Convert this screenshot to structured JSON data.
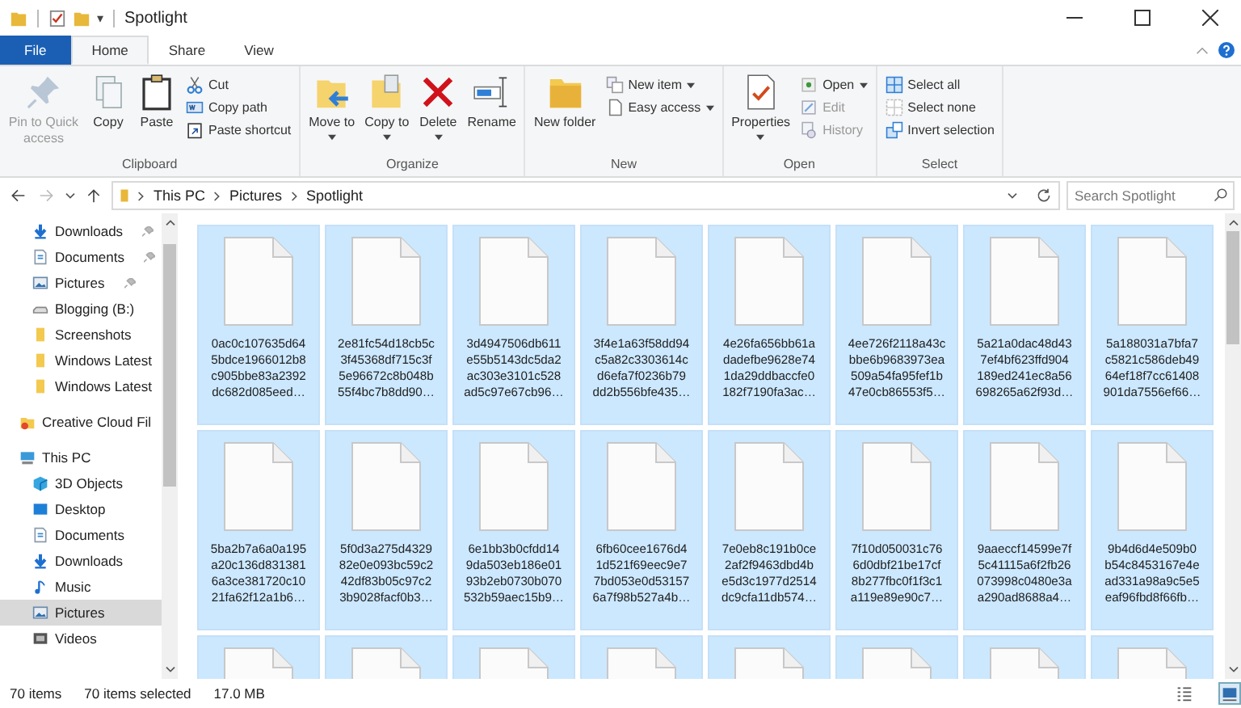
{
  "title_bar": {
    "title": "Spotlight",
    "customize_caret": "▾"
  },
  "tabs": [
    {
      "label": "File",
      "kind": "file",
      "selected": false
    },
    {
      "label": "Home",
      "kind": "tab",
      "selected": true
    },
    {
      "label": "Share",
      "kind": "tab",
      "selected": false
    },
    {
      "label": "View",
      "kind": "tab",
      "selected": false
    }
  ],
  "ribbon": {
    "groups": [
      {
        "label": "Clipboard",
        "large": [
          {
            "label": "Pin to Quick access",
            "kind": "pin",
            "disabled": true,
            "dropdown": false
          },
          {
            "label": "Copy",
            "kind": "copy",
            "disabled": false,
            "dropdown": false
          },
          {
            "label": "Paste",
            "kind": "paste",
            "disabled": false,
            "dropdown": false
          }
        ],
        "small": [
          {
            "label": "Cut",
            "kind": "cut",
            "disabled": false,
            "dropdown": false
          },
          {
            "label": "Copy path",
            "kind": "copy-path",
            "disabled": false,
            "dropdown": false
          },
          {
            "label": "Paste shortcut",
            "kind": "paste-shortcut",
            "disabled": false,
            "dropdown": false
          }
        ]
      },
      {
        "label": "Organize",
        "large": [
          {
            "label": "Move to",
            "kind": "move",
            "disabled": false,
            "dropdown": true
          },
          {
            "label": "Copy to",
            "kind": "copy-to",
            "disabled": false,
            "dropdown": true
          },
          {
            "label": "Delete",
            "kind": "delete",
            "disabled": false,
            "dropdown": true
          },
          {
            "label": "Rename",
            "kind": "rename",
            "disabled": false,
            "dropdown": false
          }
        ]
      },
      {
        "label": "New",
        "large": [
          {
            "label": "New folder",
            "kind": "folder",
            "disabled": false,
            "dropdown": false
          }
        ],
        "small": [
          {
            "label": "New item",
            "kind": "new-item",
            "disabled": false,
            "dropdown": true
          },
          {
            "label": "Easy access",
            "kind": "easy-access",
            "disabled": false,
            "dropdown": true
          }
        ]
      },
      {
        "label": "Open",
        "large": [
          {
            "label": "Properties",
            "kind": "properties",
            "disabled": false,
            "dropdown": true
          }
        ],
        "small": [
          {
            "label": "Open",
            "kind": "open",
            "disabled": false,
            "dropdown": true
          },
          {
            "label": "Edit",
            "kind": "edit",
            "disabled": true,
            "dropdown": false
          },
          {
            "label": "History",
            "kind": "history",
            "disabled": true,
            "dropdown": false
          }
        ]
      },
      {
        "label": "Select",
        "small": [
          {
            "label": "Select all",
            "kind": "select-all",
            "disabled": false,
            "dropdown": false
          },
          {
            "label": "Select none",
            "kind": "select-none",
            "disabled": false,
            "dropdown": false
          },
          {
            "label": "Invert selection",
            "kind": "invert",
            "disabled": false,
            "dropdown": false
          }
        ]
      }
    ]
  },
  "address_bar": {
    "path": [
      "This PC",
      "Pictures",
      "Spotlight"
    ]
  },
  "search": {
    "placeholder": "Search Spotlight"
  },
  "navigation": [
    {
      "items": [
        {
          "label": "Downloads",
          "kind": "download",
          "pinned": true,
          "selected": false
        },
        {
          "label": "Documents",
          "kind": "document",
          "pinned": true,
          "selected": false
        },
        {
          "label": "Pictures",
          "kind": "picture",
          "pinned": true,
          "selected": false
        },
        {
          "label": "Blogging (B:)",
          "kind": "drive",
          "selected": false
        },
        {
          "label": "Screenshots",
          "kind": "folder",
          "selected": false
        },
        {
          "label": "Windows Latest",
          "kind": "folder",
          "selected": false
        },
        {
          "label": "Windows Latest",
          "kind": "folder",
          "selected": false
        }
      ]
    },
    {
      "items": [
        {
          "label": "Creative Cloud Fil",
          "kind": "cloud",
          "selected": false
        }
      ]
    },
    {
      "items": [
        {
          "label": "This PC",
          "kind": "pc",
          "selected": false,
          "children": [
            {
              "label": "3D Objects",
              "kind": "cube",
              "selected": false
            },
            {
              "label": "Desktop",
              "kind": "desktop",
              "selected": false
            },
            {
              "label": "Documents",
              "kind": "document",
              "selected": false
            },
            {
              "label": "Downloads",
              "kind": "download",
              "selected": false
            },
            {
              "label": "Music",
              "kind": "music",
              "selected": false
            },
            {
              "label": "Pictures",
              "kind": "picture",
              "selected": true
            },
            {
              "label": "Videos",
              "kind": "video",
              "selected": false
            }
          ]
        }
      ]
    }
  ],
  "files": [
    {
      "name_lines": [
        "0ac0c107635d64",
        "5bdce1966012b8",
        "c905bbe83a2392",
        "dc682d085eed…"
      ],
      "selected": true
    },
    {
      "name_lines": [
        "2e81fc54d18cb5c",
        "3f45368df715c3f",
        "5e96672c8b048b",
        "55f4bc7b8dd90…"
      ],
      "selected": true
    },
    {
      "name_lines": [
        "3d4947506db611",
        "e55b5143dc5da2",
        "ac303e3101c528",
        "ad5c97e67cb96…"
      ],
      "selected": true
    },
    {
      "name_lines": [
        "3f4e1a63f58dd94",
        "c5a82c3303614c",
        "d6efa7f0236b79",
        "dd2b556bfe435…"
      ],
      "selected": true
    },
    {
      "name_lines": [
        "4e26fa656bb61a",
        "dadefbe9628e74",
        "1da29ddbaccfe0",
        "182f7190fa3ac…"
      ],
      "selected": true
    },
    {
      "name_lines": [
        "4ee726f2118a43c",
        "bbe6b9683973ea",
        "509a54fa95fef1b",
        "47e0cb86553f5…"
      ],
      "selected": true
    },
    {
      "name_lines": [
        "5a21a0dac48d43",
        "7ef4bf623ffd904",
        "189ed241ec8a56",
        "698265a62f93d…"
      ],
      "selected": true
    },
    {
      "name_lines": [
        "5a188031a7bfa7",
        "c5821c586deb49",
        "64ef18f7cc61408",
        "901da7556ef66…"
      ],
      "selected": true
    },
    {
      "name_lines": [
        "5ba2b7a6a0a195",
        "a20c136d831381",
        "6a3ce381720c10",
        "21fa62f12a1b6…"
      ],
      "selected": true
    },
    {
      "name_lines": [
        "5f0d3a275d4329",
        "82e0e093bc59c2",
        "42df83b05c97c2",
        "3b9028facf0b3…"
      ],
      "selected": true
    },
    {
      "name_lines": [
        "6e1bb3b0cfdd14",
        "9da503eb186e01",
        "93b2eb0730b070",
        "532b59aec15b9…"
      ],
      "selected": true
    },
    {
      "name_lines": [
        "6fb60cee1676d4",
        "1d521f69eec9e7",
        "7bd053e0d53157",
        "6a7f98b527a4b…"
      ],
      "selected": true
    },
    {
      "name_lines": [
        "7e0eb8c191b0ce",
        "2af2f9463dbd4b",
        "e5d3c1977d2514",
        "dc9cfa11db574…"
      ],
      "selected": true
    },
    {
      "name_lines": [
        "7f10d050031c76",
        "6d0dbf21be17cf",
        "8b277fbc0f1f3c1",
        "a119e89e90c7…"
      ],
      "selected": true
    },
    {
      "name_lines": [
        "9aaeccf14599e7f",
        "5c41115a6f2fb26",
        "073998c0480e3a",
        "a290ad8688a4…"
      ],
      "selected": true
    },
    {
      "name_lines": [
        "9b4d6d4e509b0",
        "b54c8453167e4e",
        "ad331a98a9c5e5",
        "eaf96fbd8f66fb…"
      ],
      "selected": true
    },
    {
      "selected": true
    },
    {
      "selected": true
    },
    {
      "selected": true
    },
    {
      "selected": true
    },
    {
      "selected": true
    },
    {
      "selected": true
    },
    {
      "selected": true
    },
    {
      "selected": true
    }
  ],
  "status_bar": {
    "item_count": "70 items",
    "selection": "70 items selected",
    "size": "17.0 MB"
  },
  "view_buttons": [
    {
      "kind": "details",
      "selected": false
    },
    {
      "kind": "large-icons",
      "selected": true
    }
  ]
}
